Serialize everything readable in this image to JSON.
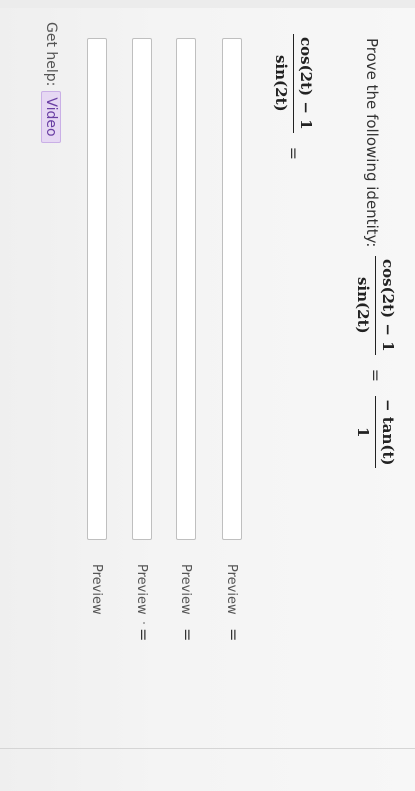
{
  "question": {
    "prompt": "Prove the following identity:",
    "identity": {
      "lhs_num": "cos(2t) − 1",
      "lhs_den": "sin(2t)",
      "equals": "=",
      "rhs_num": "− tan(t)",
      "rhs_den": "1"
    },
    "work_start": {
      "num": "cos(2t) − 1",
      "den": "sin(2t)",
      "equals": "="
    }
  },
  "rows": [
    {
      "preview_label": "Preview",
      "value": "",
      "trailing_equals": "="
    },
    {
      "preview_label": "Preview",
      "value": "",
      "trailing_equals": "="
    },
    {
      "preview_label": "Preview",
      "value": "",
      "trailing_equals": "="
    },
    {
      "preview_label": "Preview",
      "value": "",
      "trailing_equals": ""
    }
  ],
  "help": {
    "label": "Get help:",
    "video_label": "Video"
  }
}
